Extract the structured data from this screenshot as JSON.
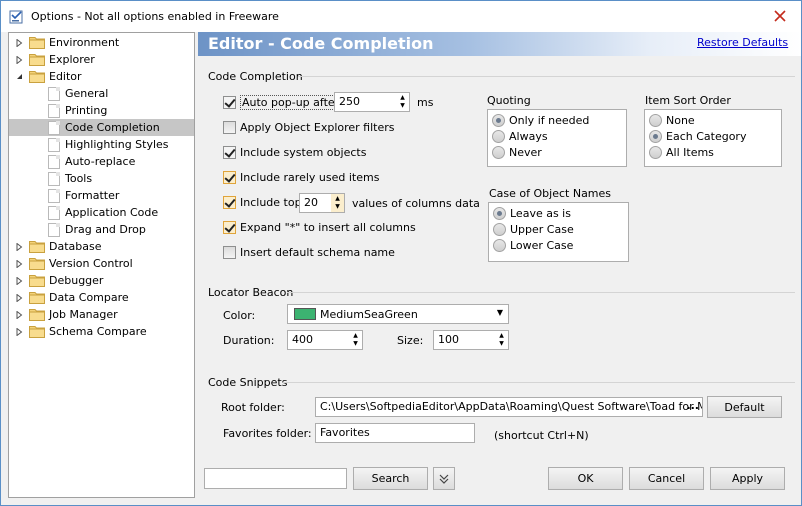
{
  "window": {
    "title": "Options - Not all options enabled in Freeware"
  },
  "tree": {
    "items": [
      {
        "label": "Environment",
        "type": "folder",
        "state": "collapsed"
      },
      {
        "label": "Explorer",
        "type": "folder",
        "state": "collapsed"
      },
      {
        "label": "Editor",
        "type": "folder",
        "state": "expanded"
      },
      {
        "label": "General",
        "type": "leaf"
      },
      {
        "label": "Printing",
        "type": "leaf"
      },
      {
        "label": "Code Completion",
        "type": "leaf",
        "selected": true
      },
      {
        "label": "Highlighting Styles",
        "type": "leaf"
      },
      {
        "label": "Auto-replace",
        "type": "leaf"
      },
      {
        "label": "Tools",
        "type": "leaf"
      },
      {
        "label": "Formatter",
        "type": "leaf"
      },
      {
        "label": "Application Code",
        "type": "leaf"
      },
      {
        "label": "Drag and Drop",
        "type": "leaf"
      },
      {
        "label": "Database",
        "type": "folder",
        "state": "collapsed"
      },
      {
        "label": "Version Control",
        "type": "folder",
        "state": "collapsed"
      },
      {
        "label": "Debugger",
        "type": "folder",
        "state": "collapsed"
      },
      {
        "label": "Data Compare",
        "type": "folder",
        "state": "collapsed"
      },
      {
        "label": "Job Manager",
        "type": "folder",
        "state": "collapsed"
      },
      {
        "label": "Schema Compare",
        "type": "folder",
        "state": "collapsed"
      }
    ]
  },
  "header": {
    "title": "Editor - Code Completion",
    "restore_label": "Restore Defaults"
  },
  "code_completion": {
    "group_label": "Code Completion",
    "auto_popup": {
      "label": "Auto pop-up after",
      "checked": true,
      "value": "250",
      "unit": "ms"
    },
    "apply_filters": {
      "label": "Apply Object Explorer filters",
      "checked": false
    },
    "include_system": {
      "label": "Include system objects",
      "checked": true
    },
    "include_rarely": {
      "label": "Include rarely used items",
      "checked": true
    },
    "include_top": {
      "label": "Include top",
      "checked": true,
      "value": "20",
      "suffix": "values of columns data"
    },
    "expand_star": {
      "label": "Expand \"*\" to insert all columns",
      "checked": true
    },
    "insert_schema": {
      "label": "Insert default schema name",
      "checked": false
    }
  },
  "quoting": {
    "label": "Quoting",
    "options": [
      "Only if needed",
      "Always",
      "Never"
    ],
    "selected": 0
  },
  "item_sort": {
    "label": "Item Sort Order",
    "options": [
      "None",
      "Each Category",
      "All Items"
    ],
    "selected": 1
  },
  "case_names": {
    "label": "Case of Object Names",
    "options": [
      "Leave as is",
      "Upper Case",
      "Lower Case"
    ],
    "selected": 0
  },
  "locator": {
    "group_label": "Locator Beacon",
    "color_label": "Color:",
    "color_value": "MediumSeaGreen",
    "swatch_color": "#3cb371",
    "duration_label": "Duration:",
    "duration_value": "400",
    "size_label": "Size:",
    "size_value": "100"
  },
  "snippets": {
    "group_label": "Code Snippets",
    "root_label": "Root folder:",
    "root_value": "C:\\Users\\SoftpediaEditor\\AppData\\Roaming\\Quest Software\\Toad for MySQ",
    "browse_label": "...",
    "default_label": "Default",
    "favorites_label": "Favorites folder:",
    "favorites_value": "Favorites",
    "shortcut_text": "(shortcut Ctrl+N)"
  },
  "footer": {
    "search_value": "",
    "search_label": "Search",
    "ok_label": "OK",
    "cancel_label": "Cancel",
    "apply_label": "Apply"
  }
}
